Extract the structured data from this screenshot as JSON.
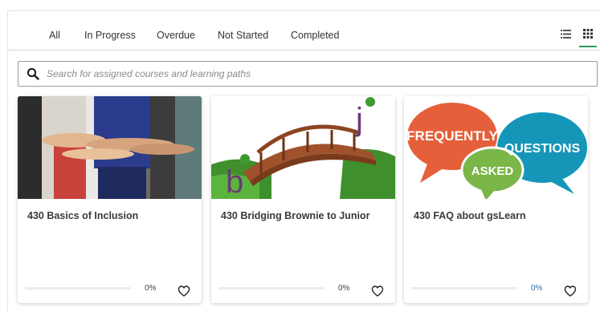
{
  "tabs": [
    {
      "label": "All",
      "active": true
    },
    {
      "label": "In Progress",
      "active": false
    },
    {
      "label": "Overdue",
      "active": false
    },
    {
      "label": "Not Started",
      "active": false
    },
    {
      "label": "Completed",
      "active": false
    }
  ],
  "view_toggle": {
    "list_icon": "list-view-icon",
    "grid_icon": "grid-view-icon",
    "active": "grid"
  },
  "search": {
    "placeholder": "Search for assigned courses and learning paths",
    "value": "",
    "icon": "search-icon"
  },
  "courses": [
    {
      "title": "430 Basics of Inclusion",
      "image": "people-linking-arms-photo",
      "progress_percent": 0,
      "progress_label": "0%",
      "progress_label_color": "#444444",
      "favorite_icon": "heart-outline-icon"
    },
    {
      "title": "430 Bridging Brownie to Junior",
      "image": "bridge-b-to-j-illustration",
      "progress_percent": 0,
      "progress_label": "0%",
      "progress_label_color": "#444444",
      "favorite_icon": "heart-outline-icon"
    },
    {
      "title": "430 FAQ about gsLearn",
      "image": "faq-speech-bubbles-illustration",
      "image_text": {
        "bubble1": "FREQUENTLY",
        "bubble2": "QUESTIONS",
        "bubble3": "ASKED"
      },
      "progress_percent": 0,
      "progress_label": "0%",
      "progress_label_color": "#2a6fb5",
      "favorite_icon": "heart-outline-icon"
    }
  ],
  "colors": {
    "accent": "#2e9d59",
    "faq_orange": "#e5603a",
    "faq_teal": "#1596b8",
    "faq_green": "#7ab648"
  }
}
